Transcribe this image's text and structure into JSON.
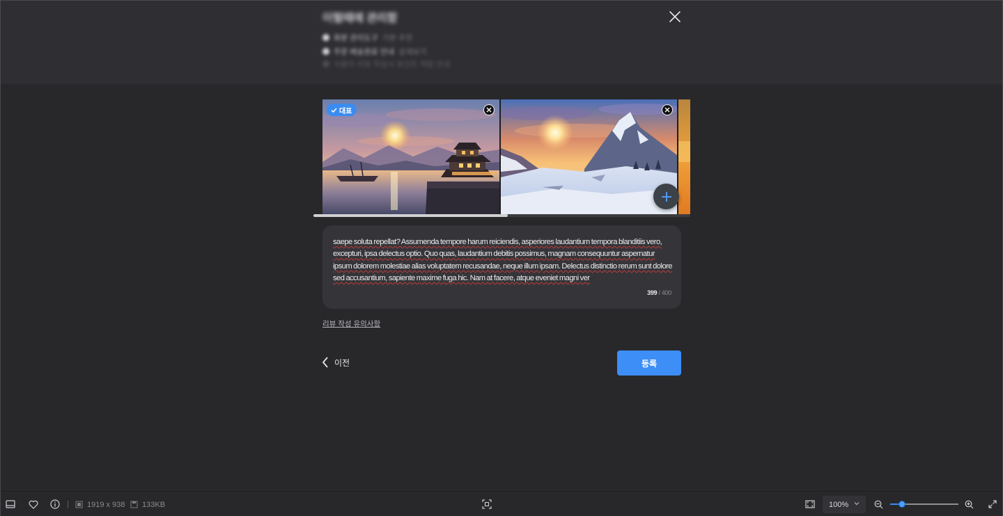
{
  "header": {
    "title": "이럴때에 관리함",
    "lines": [
      {
        "main": "화분 관리도구",
        "sub": "기본 추천"
      },
      {
        "main": "주문 배송완료 안내",
        "sub": "상세보기"
      },
      {
        "main": "사용자 리뷰 작성시 포인트 적립 안내",
        "sub": ""
      }
    ]
  },
  "carousel": {
    "representative_badge": "대표",
    "images": [
      {
        "name": "lake-pagoda-sunset"
      },
      {
        "name": "snowy-mountain-sunset"
      },
      {
        "name": "orange-partial"
      }
    ],
    "scroll_position": 0.5
  },
  "review": {
    "text": " saepe soluta repellat? Assumenda tempore harum reiciendis, asperiores laudantium tempora blanditiis vero, excepturi, ipsa delectus optio. Quo quas, laudantium debitis possimus, magnam consequuntur aspernatur ipsum dolorem molestiae alias voluptatem recusandae, neque illum ipsam. Delectus distinctio rerum sunt dolore sed accusantium, sapiente maxime fuga hic. Nam at facere, atque eveniet magni ver",
    "count": "399",
    "max": "/ 400"
  },
  "guide_link": "리뷰 작성 유의사항",
  "actions": {
    "back": "이전",
    "submit": "등록"
  },
  "toolbar": {
    "dimensions": "1919 x 938",
    "file_size": "133KB",
    "zoom": "100%",
    "zoom_level": 0.17
  },
  "colors": {
    "accent": "#3d8ef6",
    "background": "#28282b",
    "panel": "#353539"
  }
}
